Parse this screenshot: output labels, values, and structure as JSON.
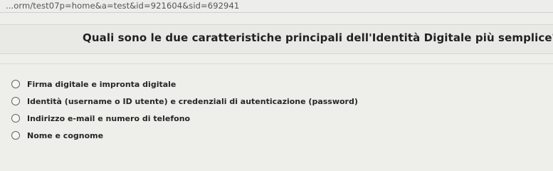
{
  "browser": {
    "url": "...orm/test07p=home&a=test&id=921604&sid=692941"
  },
  "quiz": {
    "question": "Quali sono le due caratteristiche principali dell'Identità Digitale più semplice?",
    "options": [
      {
        "label": "Firma digitale e impronta digitale"
      },
      {
        "label": "Identità (username o ID utente) e credenziali di autenticazione (password)"
      },
      {
        "label": "Indirizzo e-mail e numero di telefono"
      },
      {
        "label": "Nome e cognome"
      }
    ]
  }
}
